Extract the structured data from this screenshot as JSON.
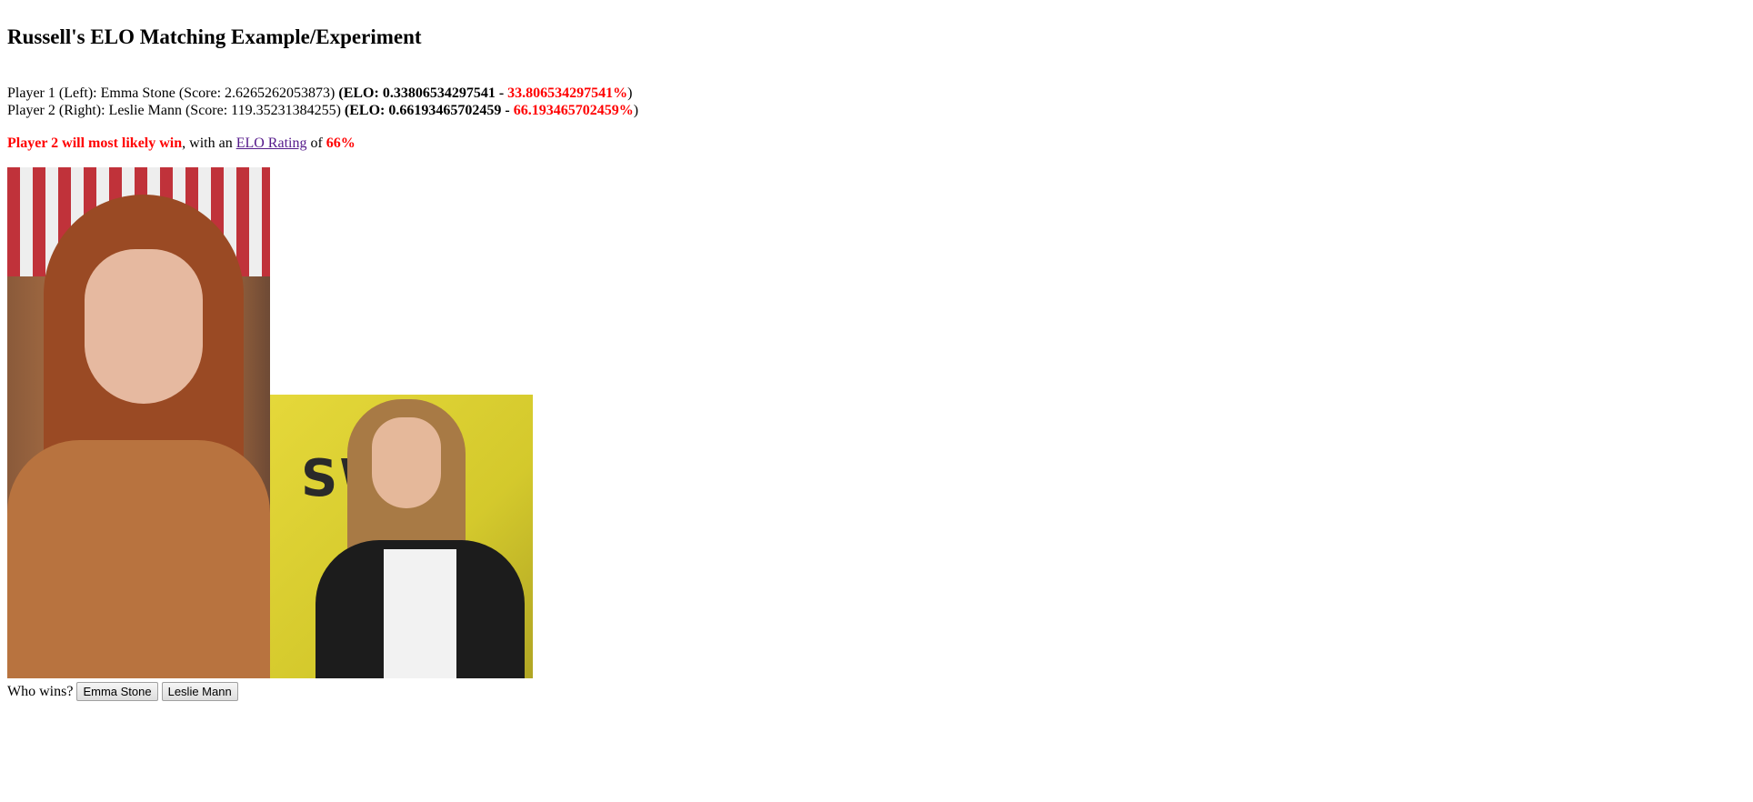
{
  "page": {
    "title": "Russell's ELO Matching Example/Experiment"
  },
  "players": [
    {
      "label": "Player 1 (Left): Emma Stone (Score: 2.6265262053873)",
      "elo_prefix": "(ELO: 0.33806534297541",
      "elo_sep": " - ",
      "elo_percent": "33.806534297541%",
      "elo_suffix": ")"
    },
    {
      "label": "Player 2 (Right): Leslie Mann (Score: 119.35231384255)",
      "elo_prefix": "(ELO: 0.66193465702459",
      "elo_sep": " - ",
      "elo_percent": "66.193465702459%",
      "elo_suffix": ")"
    }
  ],
  "prediction": {
    "winner_text": "Player 2 will most likely win",
    "middle_text": ", with an ",
    "link_text": "ELO Rating",
    "of_text": " of ",
    "rating": "66%"
  },
  "images": {
    "left_alt": "Emma Stone",
    "right_alt": "Leslie Mann",
    "right_logo_text": "SW"
  },
  "vote": {
    "prompt": "Who wins?",
    "option_left": "Emma Stone",
    "option_right": "Leslie Mann"
  },
  "colors": {
    "highlight": "#ff0000",
    "visited_link": "#551a8b"
  }
}
